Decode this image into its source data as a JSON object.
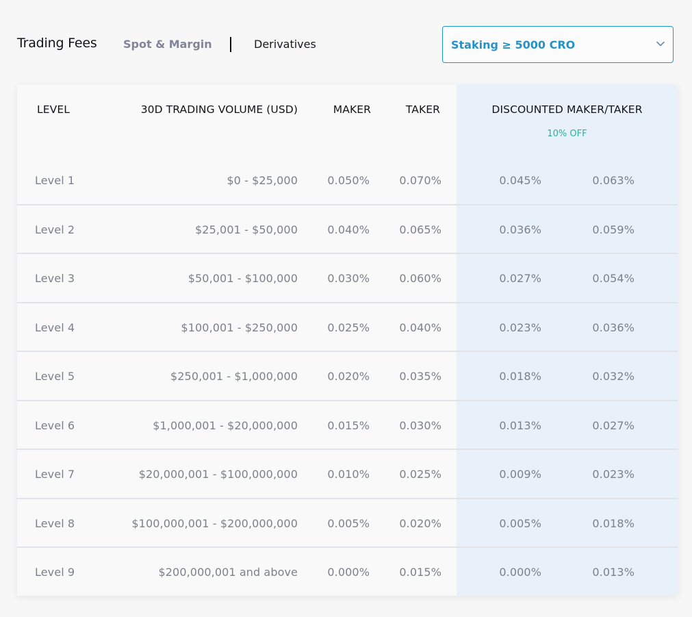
{
  "header": {
    "title": "Trading Fees",
    "tabs": [
      {
        "label": "Spot & Margin",
        "active": false
      },
      {
        "label": "Derivatives",
        "active": true
      }
    ],
    "dropdown": {
      "selected": "Staking ≥ 5000 CRO",
      "icon": "chevron-down-icon"
    }
  },
  "table": {
    "columns": {
      "level": "LEVEL",
      "volume": "30D TRADING VOLUME (USD)",
      "maker": "MAKER",
      "taker": "TAKER",
      "discounted": "DISCOUNTED MAKER/TAKER"
    },
    "discount_badge": "10% OFF",
    "colors": {
      "accent": "#2891c6",
      "discount": "#2bb19a",
      "discount_bg": "#e8f1fa"
    },
    "rows": [
      {
        "level": "Level 1",
        "volume": "$0 - $25,000",
        "maker": "0.050%",
        "taker": "0.070%",
        "d_maker": "0.045%",
        "d_taker": "0.063%"
      },
      {
        "level": "Level 2",
        "volume": "$25,001 - $50,000",
        "maker": "0.040%",
        "taker": "0.065%",
        "d_maker": "0.036%",
        "d_taker": "0.059%"
      },
      {
        "level": "Level 3",
        "volume": "$50,001 - $100,000",
        "maker": "0.030%",
        "taker": "0.060%",
        "d_maker": "0.027%",
        "d_taker": "0.054%"
      },
      {
        "level": "Level 4",
        "volume": "$100,001 - $250,000",
        "maker": "0.025%",
        "taker": "0.040%",
        "d_maker": "0.023%",
        "d_taker": "0.036%"
      },
      {
        "level": "Level 5",
        "volume": "$250,001 - $1,000,000",
        "maker": "0.020%",
        "taker": "0.035%",
        "d_maker": "0.018%",
        "d_taker": "0.032%"
      },
      {
        "level": "Level 6",
        "volume": "$1,000,001 - $20,000,000",
        "maker": "0.015%",
        "taker": "0.030%",
        "d_maker": "0.013%",
        "d_taker": "0.027%"
      },
      {
        "level": "Level 7",
        "volume": "$20,000,001 - $100,000,000",
        "maker": "0.010%",
        "taker": "0.025%",
        "d_maker": "0.009%",
        "d_taker": "0.023%"
      },
      {
        "level": "Level 8",
        "volume": "$100,000,001 - $200,000,000",
        "maker": "0.005%",
        "taker": "0.020%",
        "d_maker": "0.005%",
        "d_taker": "0.018%"
      },
      {
        "level": "Level 9",
        "volume": "$200,000,001 and above",
        "maker": "0.000%",
        "taker": "0.015%",
        "d_maker": "0.000%",
        "d_taker": "0.013%"
      }
    ]
  }
}
